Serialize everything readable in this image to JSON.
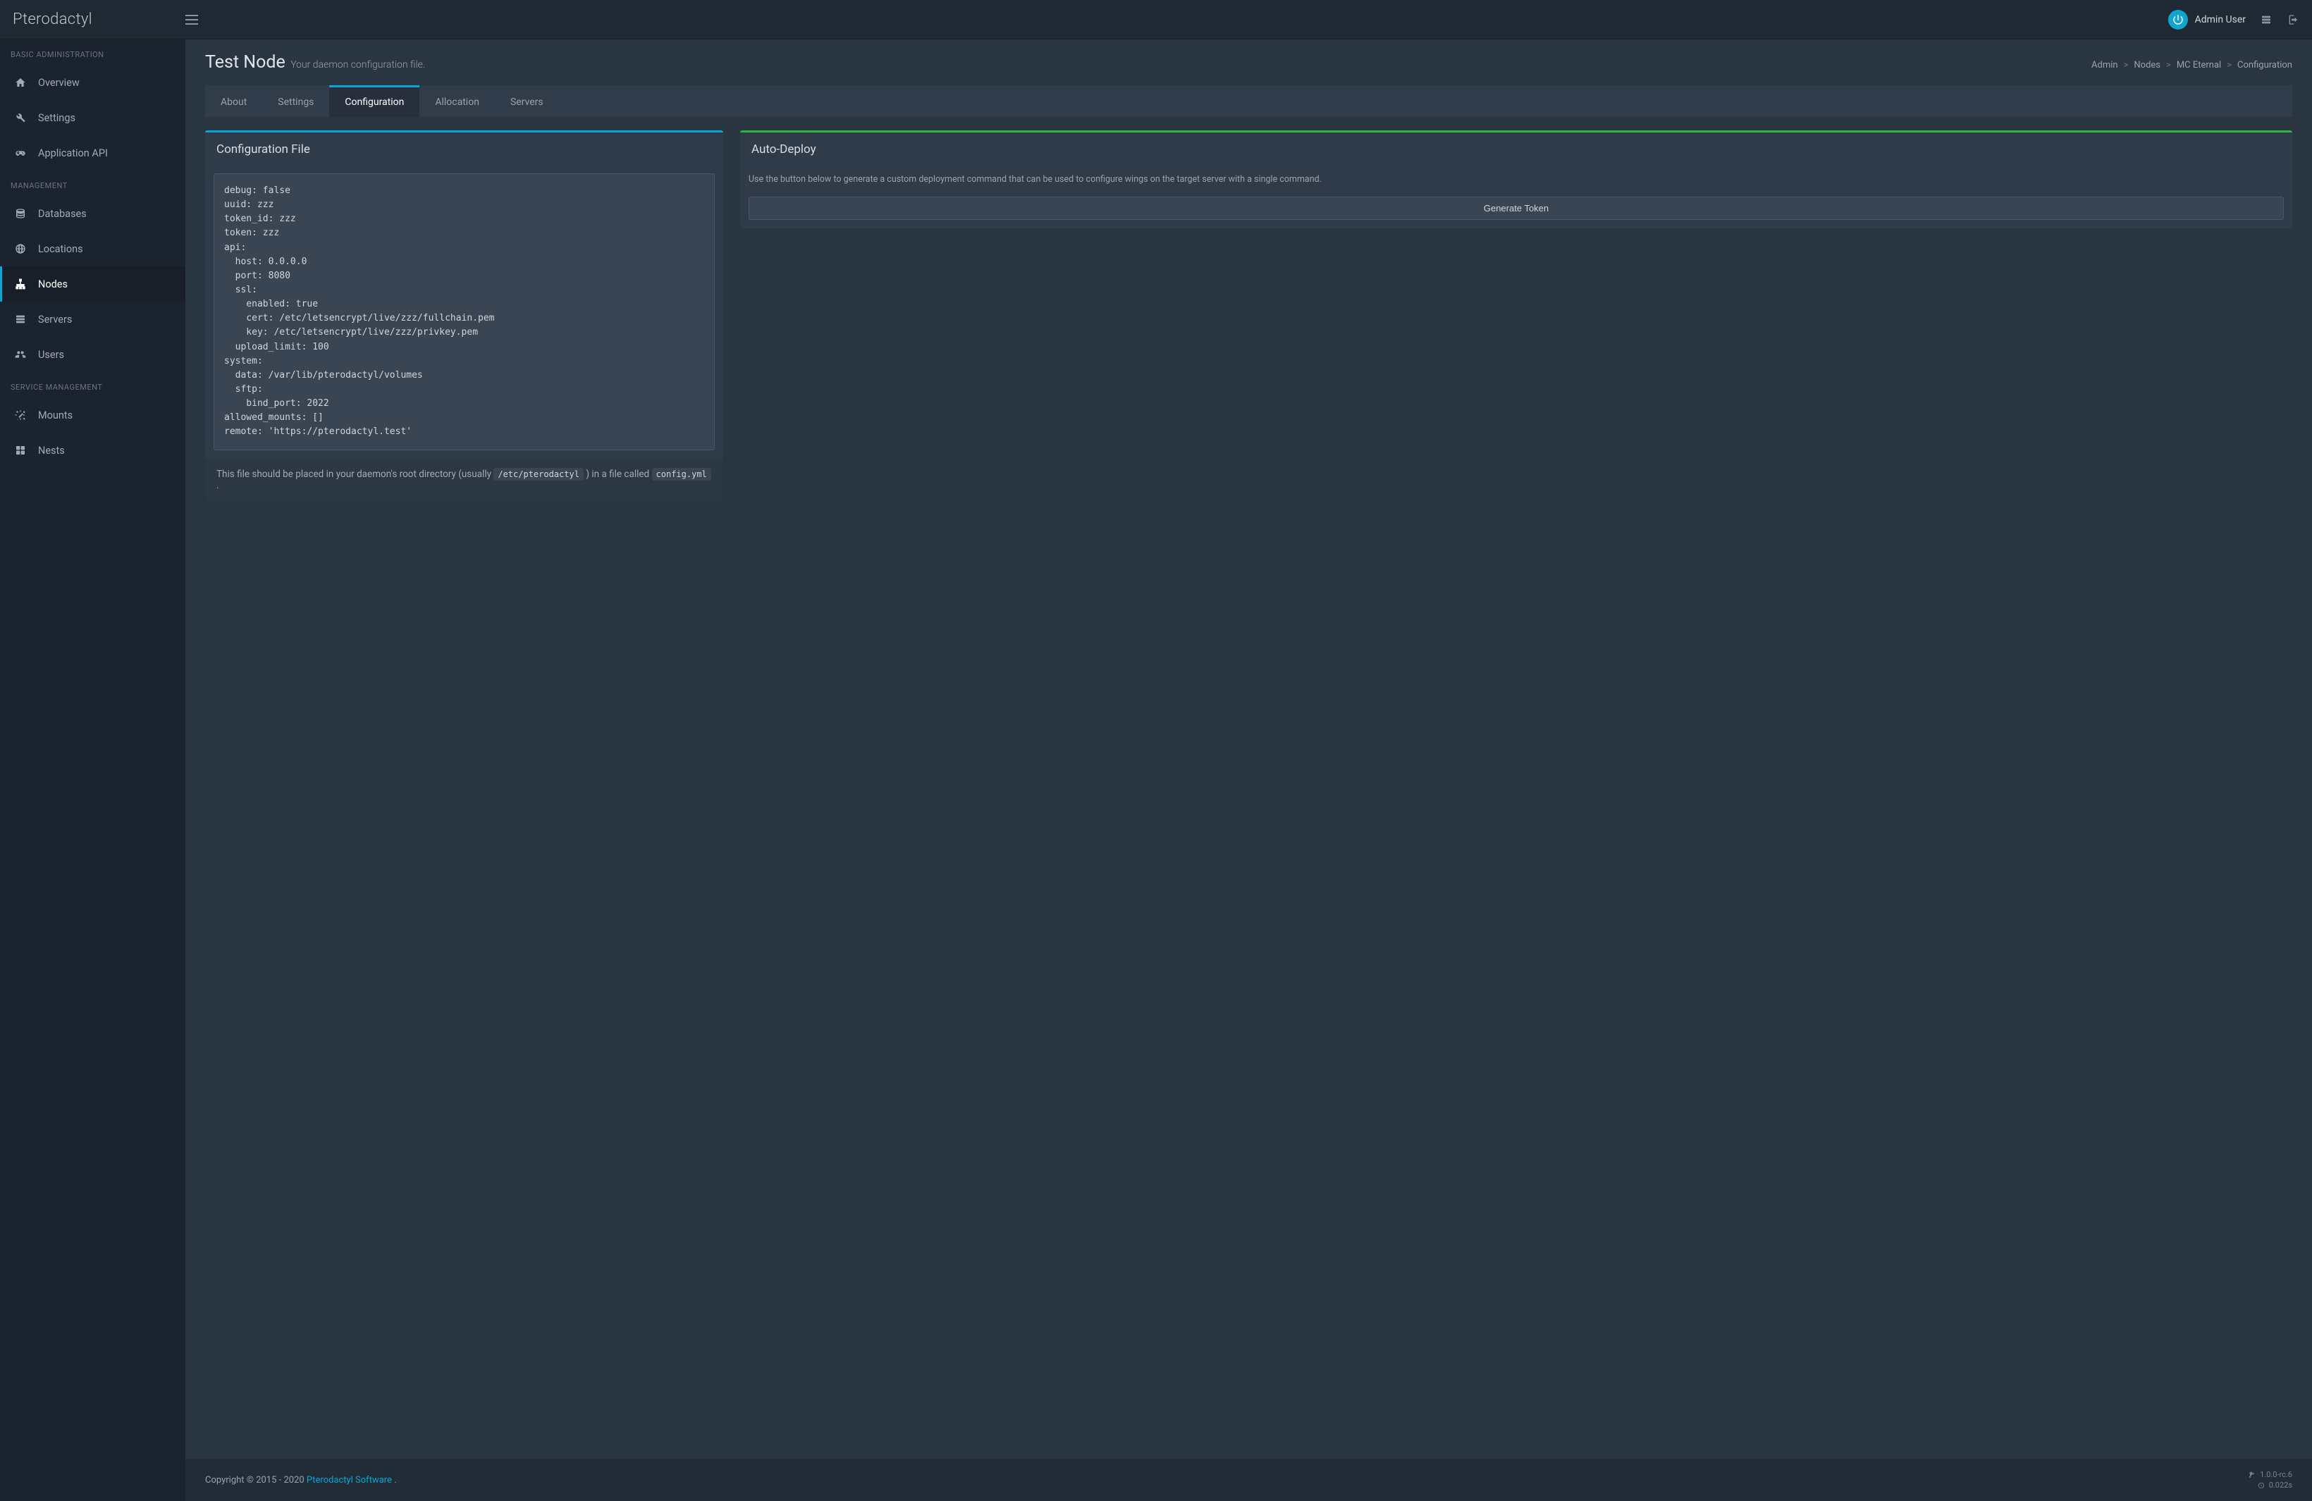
{
  "brand": "Pterodactyl",
  "user": {
    "name": "Admin User"
  },
  "sidebar": {
    "sections": [
      {
        "title": "BASIC ADMINISTRATION",
        "items": [
          {
            "label": "Overview",
            "icon": "home-icon",
            "active": false
          },
          {
            "label": "Settings",
            "icon": "wrench-icon",
            "active": false
          },
          {
            "label": "Application API",
            "icon": "gamepad-icon",
            "active": false
          }
        ]
      },
      {
        "title": "MANAGEMENT",
        "items": [
          {
            "label": "Databases",
            "icon": "database-icon",
            "active": false
          },
          {
            "label": "Locations",
            "icon": "globe-icon",
            "active": false
          },
          {
            "label": "Nodes",
            "icon": "sitemap-icon",
            "active": true
          },
          {
            "label": "Servers",
            "icon": "server-icon",
            "active": false
          },
          {
            "label": "Users",
            "icon": "users-icon",
            "active": false
          }
        ]
      },
      {
        "title": "SERVICE MANAGEMENT",
        "items": [
          {
            "label": "Mounts",
            "icon": "magic-icon",
            "active": false
          },
          {
            "label": "Nests",
            "icon": "th-large-icon",
            "active": false
          }
        ]
      }
    ]
  },
  "page": {
    "title": "Test Node",
    "subtitle": "Your daemon configuration file."
  },
  "breadcrumb": {
    "items": [
      "Admin",
      "Nodes",
      "MC Eternal",
      "Configuration"
    ]
  },
  "tabs": {
    "items": [
      {
        "label": "About",
        "active": false
      },
      {
        "label": "Settings",
        "active": false
      },
      {
        "label": "Configuration",
        "active": true
      },
      {
        "label": "Allocation",
        "active": false
      },
      {
        "label": "Servers",
        "active": false
      }
    ]
  },
  "configBox": {
    "title": "Configuration File",
    "content": "debug: false\nuuid: zzz\ntoken_id: zzz\ntoken: zzz\napi:\n  host: 0.0.0.0\n  port: 8080\n  ssl:\n    enabled: true\n    cert: /etc/letsencrypt/live/zzz/fullchain.pem\n    key: /etc/letsencrypt/live/zzz/privkey.pem\n  upload_limit: 100\nsystem:\n  data: /var/lib/pterodactyl/volumes\n  sftp:\n    bind_port: 2022\nallowed_mounts: []\nremote: 'https://pterodactyl.test'",
    "footer_pre": "This file should be placed in your daemon's root directory (usually ",
    "footer_code1": "/etc/pterodactyl",
    "footer_mid": " ) in a file called ",
    "footer_code2": "config.yml",
    "footer_post": " ."
  },
  "deployBox": {
    "title": "Auto-Deploy",
    "help": "Use the button below to generate a custom deployment command that can be used to configure wings on the target server with a single command.",
    "button": "Generate Token"
  },
  "footer": {
    "copyright_pre": "Copyright © 2015 - 2020 ",
    "link": "Pterodactyl Software",
    "copyright_post": ".",
    "version": "1.0.0-rc.6",
    "time": "0.022s"
  }
}
